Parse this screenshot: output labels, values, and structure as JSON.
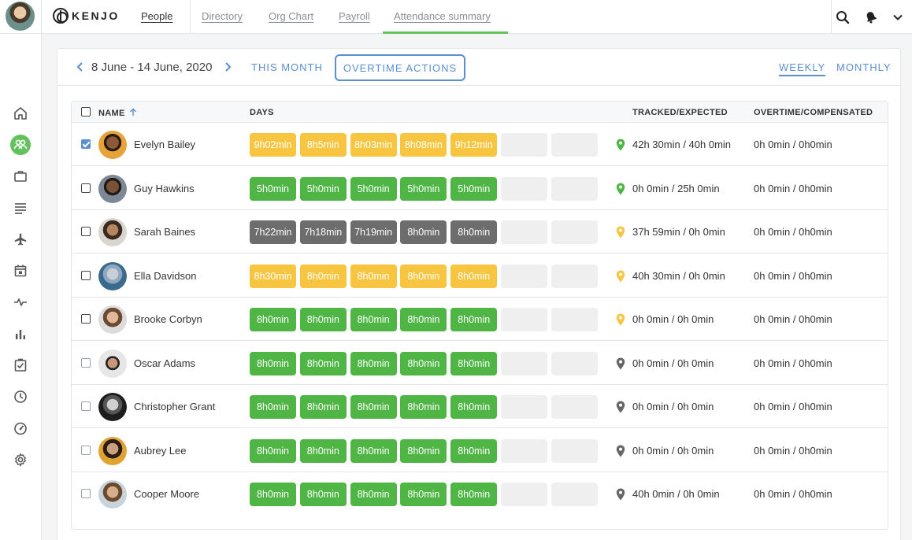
{
  "nav": {
    "logo": "KENJO",
    "tabs": [
      {
        "label": "People"
      },
      {
        "label": "Directory"
      },
      {
        "label": "Org Chart"
      },
      {
        "label": "Payroll"
      },
      {
        "label": "Attendance summary"
      }
    ],
    "active_tab": "Attendance summary"
  },
  "toolbar": {
    "date_range": "8 June - 14 June, 2020",
    "this_month": "THIS MONTH",
    "overtime_actions": "OVERTIME ACTIONS",
    "weekly": "WEEKLY",
    "monthly": "MONTHLY"
  },
  "table": {
    "headers": {
      "name": "NAME",
      "days": "DAYS",
      "tracked": "TRACKED/EXPECTED",
      "overtime": "OVERTIME/COMPENSATED"
    },
    "rows": [
      {
        "name": "Evelyn Bailey",
        "checked": true,
        "days": [
          "9h02min",
          "8h5min",
          "8h03min",
          "8h08min",
          "9h12min",
          "",
          ""
        ],
        "status": "yellow",
        "pin": "green",
        "tracked": "42h 30min / 40h 0min",
        "overtime": "0h 0min / 0h0min"
      },
      {
        "name": "Guy Hawkins",
        "checked": false,
        "days": [
          "5h0min",
          "5h0min",
          "5h0min",
          "5h0min",
          "5h0min",
          "",
          ""
        ],
        "status": "green",
        "pin": "green",
        "tracked": "0h 0min / 25h 0min",
        "overtime": "0h 0min / 0h0min"
      },
      {
        "name": "Sarah Baines",
        "checked": false,
        "days": [
          "7h22min",
          "7h18min",
          "7h19min",
          "8h0min",
          "8h0min",
          "",
          ""
        ],
        "status": "gray",
        "pin": "yellow",
        "tracked": "37h 59min / 0h 0min",
        "overtime": "0h 0min / 0h0min"
      },
      {
        "name": "Ella Davidson",
        "checked": false,
        "days": [
          "8h30min",
          "8h0min",
          "8h0min",
          "8h0min",
          "8h0min",
          "",
          ""
        ],
        "status": "yellow",
        "pin": "yellow",
        "tracked": "40h 30min / 0h 0min",
        "overtime": "0h 0min / 0h0min"
      },
      {
        "name": "Brooke Corbyn",
        "checked": false,
        "days": [
          "8h0min",
          "8h0min",
          "8h0min",
          "8h0min",
          "8h0min",
          "",
          ""
        ],
        "status": "green",
        "pin": "yellow",
        "tracked": "0h 0min / 0h 0min",
        "overtime": "0h 0min / 0h0min"
      },
      {
        "name": "Oscar Adams",
        "checked": false,
        "days": [
          "8h0min",
          "8h0min",
          "8h0min",
          "8h0min",
          "8h0min",
          "",
          ""
        ],
        "status": "green",
        "pin": "gray",
        "tracked": "0h 0min / 0h 0min",
        "overtime": "0h 0min / 0h0min"
      },
      {
        "name": "Christopher Grant",
        "checked": false,
        "days": [
          "8h0min",
          "8h0min",
          "8h0min",
          "8h0min",
          "8h0min",
          "",
          ""
        ],
        "status": "green",
        "pin": "gray",
        "tracked": "0h 0min / 0h 0min",
        "overtime": "0h 0min / 0h0min"
      },
      {
        "name": "Aubrey Lee",
        "checked": false,
        "days": [
          "8h0min",
          "8h0min",
          "8h0min",
          "8h0min",
          "8h0min",
          "",
          ""
        ],
        "status": "green",
        "pin": "gray",
        "tracked": "0h 0min / 0h 0min",
        "overtime": "0h 0min / 0h0min"
      },
      {
        "name": "Cooper Moore",
        "checked": false,
        "days": [
          "8h0min",
          "8h0min",
          "8h0min",
          "8h0min",
          "8h0min",
          "",
          ""
        ],
        "status": "green",
        "pin": "gray",
        "tracked": "40h 0min / 0h 0min",
        "overtime": "0h 0min / 0h0min"
      }
    ]
  },
  "colors": {
    "accent": "#5a8fcf",
    "green": "#4fb645",
    "yellow": "#f7c540",
    "gray": "#6d6d6d",
    "nav_active": "#62c25e"
  },
  "icons": {
    "sidebar": [
      "home-icon",
      "people-icon",
      "briefcase-icon",
      "document-icon",
      "plane-icon",
      "calendar-icon",
      "activity-icon",
      "bar-chart-icon",
      "checklist-icon",
      "clock-icon",
      "speedometer-icon",
      "gear-icon"
    ],
    "top": [
      "search-icon",
      "bell-icon",
      "chevron-down-icon"
    ]
  }
}
